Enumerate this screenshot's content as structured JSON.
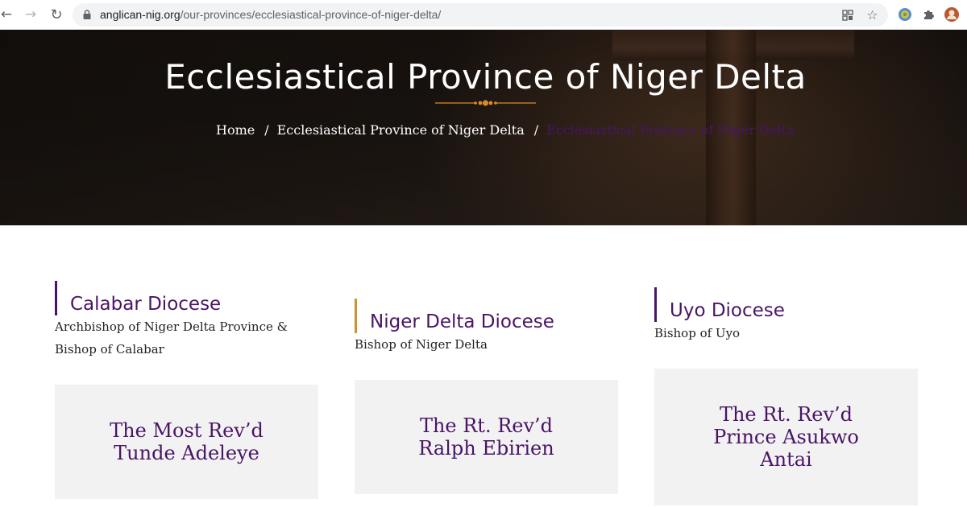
{
  "browser": {
    "url_domain": "anglican-nig.org",
    "url_path": "/our-provinces/ecclesiastical-province-of-niger-delta/",
    "icons": [
      "back-icon",
      "forward-icon",
      "reload-icon",
      "lock-icon",
      "apps-icon",
      "star-icon",
      "globe-icon",
      "puzzle-icon",
      "avatar-icon"
    ]
  },
  "hero": {
    "title": "Ecclesiastical Province of Niger Delta",
    "breadcrumb": {
      "home": "Home",
      "separator": "/",
      "parent": "Ecclesiastical Province of Niger Delta",
      "current": "Ecclesiastical Province of Niger Delta"
    }
  },
  "dioceses": [
    {
      "name": "Calabar Diocese",
      "role_line1": "Archbishop of Niger Delta Province &",
      "role_line2": "Bishop of Calabar",
      "bishop_line1": "The Most Rev’d",
      "bishop_line2": "Tunde Adeleye",
      "bishop_line3": "",
      "accent": "#4a1466"
    },
    {
      "name": "Niger Delta Diocese",
      "role_line1": "Bishop of Niger Delta",
      "role_line2": "",
      "bishop_line1": "The Rt. Rev’d",
      "bishop_line2": "Ralph Ebirien",
      "bishop_line3": "",
      "accent": "#c8962e"
    },
    {
      "name": "Uyo Diocese",
      "role_line1": "Bishop of Uyo",
      "role_line2": "",
      "bishop_line1": "The Rt. Rev’d",
      "bishop_line2": "Prince Asukwo",
      "bishop_line3": "Antai",
      "accent": "#4a1466"
    }
  ],
  "colors": {
    "brand_purple": "#4a1466",
    "gold": "#c8962e",
    "card_bg": "#f2f2f3"
  }
}
